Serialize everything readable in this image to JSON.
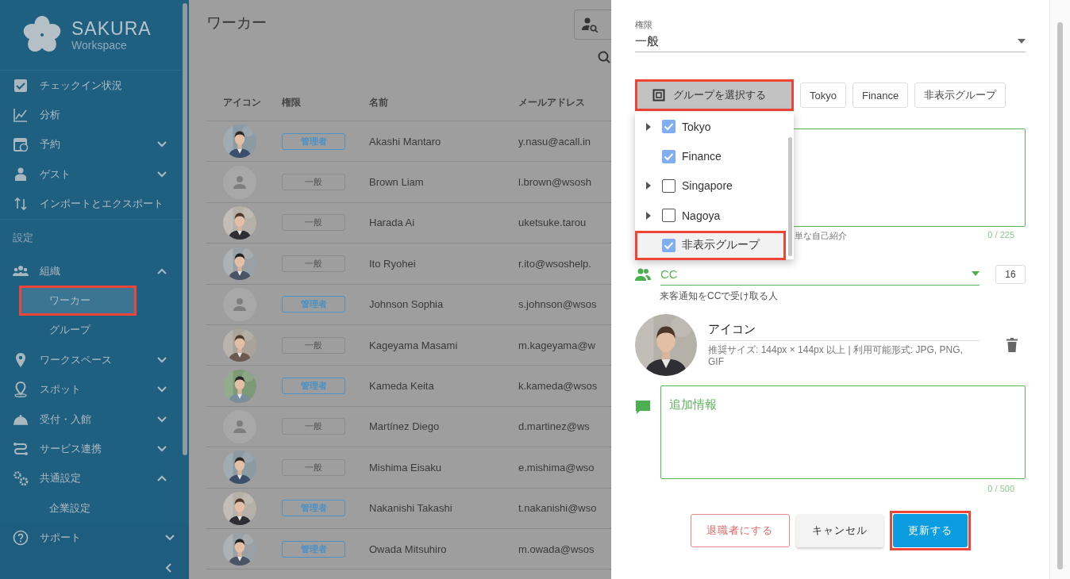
{
  "sidebar": {
    "logo": {
      "title": "SAKURA",
      "subtitle": "Workspace"
    },
    "items": [
      {
        "kind": "item",
        "label": "チェックイン状況"
      },
      {
        "kind": "item",
        "label": "分析"
      },
      {
        "kind": "item",
        "label": "予約",
        "expanded": false
      },
      {
        "kind": "item",
        "label": "ゲスト",
        "expanded": false
      },
      {
        "kind": "item",
        "label": "インポートとエクスポート"
      },
      {
        "kind": "section",
        "label": "設定"
      },
      {
        "kind": "item",
        "label": "組織",
        "expanded": true,
        "children": [
          {
            "label": "ワーカー",
            "selected": true,
            "highlighted": true
          },
          {
            "label": "グループ",
            "selected": false,
            "highlighted": false
          }
        ]
      },
      {
        "kind": "item",
        "label": "ワークスペース",
        "expanded": false
      },
      {
        "kind": "item",
        "label": "スポット",
        "expanded": false
      },
      {
        "kind": "item",
        "label": "受付・入館",
        "expanded": false
      },
      {
        "kind": "item",
        "label": "サービス連携",
        "expanded": false
      },
      {
        "kind": "item",
        "label": "共通設定",
        "expanded": true,
        "children": [
          {
            "label": "企業設定",
            "selected": false,
            "highlighted": false
          }
        ]
      }
    ],
    "footer": {
      "label": "サポート",
      "expanded": false
    }
  },
  "page": {
    "title": "ワーカー"
  },
  "table": {
    "columns": [
      "アイコン",
      "権限",
      "名前",
      "メールアドレス"
    ],
    "rows": [
      {
        "role": {
          "label": "管理者",
          "kind": "admin"
        },
        "name": "Akashi Mantaro",
        "email": "y.nasu@acall.in"
      },
      {
        "avatar": {
          "kind": "default"
        },
        "role": {
          "label": "一般",
          "kind": "general"
        },
        "name": "Brown Liam",
        "email": "l.brown@wsosh"
      },
      {
        "role": {
          "label": "一般",
          "kind": "general"
        },
        "name": "Harada Ai",
        "email": "uketsuke.tarou"
      },
      {
        "role": {
          "label": "一般",
          "kind": "general"
        },
        "name": "Ito Ryohei",
        "email": "r.ito@wsoshelp."
      },
      {
        "avatar": {
          "kind": "default"
        },
        "role": {
          "label": "管理者",
          "kind": "admin"
        },
        "name": "Johnson Sophia",
        "email": "s.johnson@wsos"
      },
      {
        "role": {
          "label": "一般",
          "kind": "general"
        },
        "name": "Kageyama Masami",
        "email": "m.kageyama@w"
      },
      {
        "role": {
          "label": "管理者",
          "kind": "admin"
        },
        "name": "Kameda Keita",
        "email": "k.kameda@wsos"
      },
      {
        "avatar": {
          "kind": "default"
        },
        "role": {
          "label": "一般",
          "kind": "general"
        },
        "name": "Martínez Diego",
        "email": "d.martinez@ws"
      },
      {
        "role": {
          "label": "一般",
          "kind": "general"
        },
        "name": "Mishima Eisaku",
        "email": "e.mishima@wso"
      },
      {
        "role": {
          "label": "管理者",
          "kind": "admin"
        },
        "name": "Nakanishi Takashi",
        "email": "t.nakanishi@wso"
      },
      {
        "role": {
          "label": "管理者",
          "kind": "admin"
        },
        "name": "Owada Mitsuhiro",
        "email": "m.owada@wsos"
      }
    ]
  },
  "panel": {
    "permission": {
      "label": "権限",
      "value": "一般"
    },
    "group_button": {
      "label": "グループを選択する",
      "highlighted": true
    },
    "group_chips": [
      "Tokyo",
      "Finance",
      "非表示グループ"
    ],
    "group_menu": [
      {
        "label": "Tokyo",
        "expandable": true,
        "checked": true,
        "highlighted": false
      },
      {
        "label": "Finance",
        "expandable": false,
        "checked": true,
        "highlighted": false
      },
      {
        "label": "Singapore",
        "expandable": true,
        "checked": false,
        "highlighted": false
      },
      {
        "label": "Nagoya",
        "expandable": true,
        "checked": false,
        "highlighted": false
      },
      {
        "label": "非表示グループ",
        "expandable": false,
        "checked": true,
        "highlighted": true
      }
    ],
    "bio": {
      "helper": "単な自己紹介",
      "counter": "0 / 225"
    },
    "cc": {
      "label": "CC",
      "count": "16",
      "helper": "来客通知をCCで受け取る人"
    },
    "icon": {
      "title": "アイコン",
      "hint": "推奨サイズ: 144px × 144px 以上 | 利用可能形式: JPG, PNG, GIF"
    },
    "notes": {
      "placeholder": "追加情報",
      "counter": "0 / 500"
    },
    "buttons": [
      {
        "label": "退職者にする",
        "kind": "danger",
        "highlighted": false
      },
      {
        "label": "キャンセル",
        "kind": "plain",
        "highlighted": false
      },
      {
        "label": "更新する",
        "kind": "primary",
        "highlighted": true
      }
    ]
  }
}
